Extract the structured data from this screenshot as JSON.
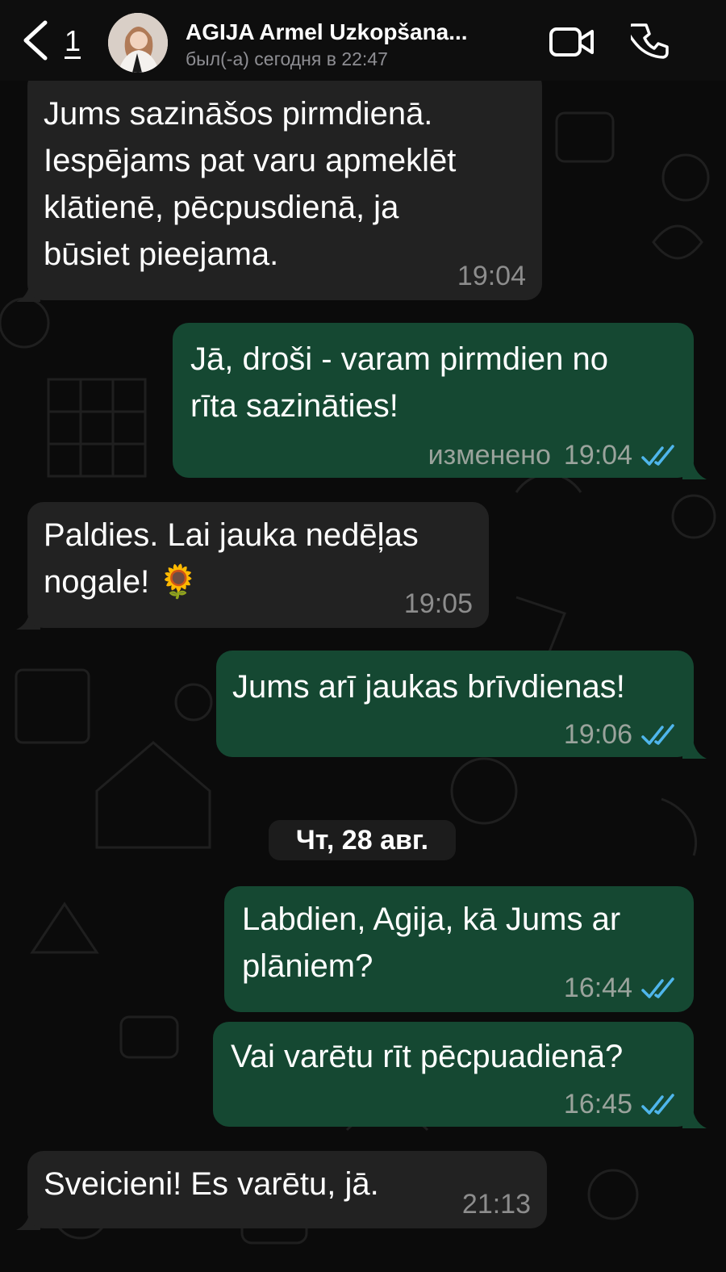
{
  "header": {
    "unread_count": "1",
    "contact_name": "AGIJA Armel Uzkopšana...",
    "status": "был(-а) сегодня в 22:47"
  },
  "colors": {
    "background": "#0b0b0b",
    "incoming_bubble": "#222222",
    "outgoing_bubble": "#154832",
    "read_checks": "#4fb6ec",
    "meta_text": "#9aa39c"
  },
  "icons": [
    "back-chevron-icon",
    "video-camera-icon",
    "phone-icon",
    "double-check-icon",
    "sunflower-emoji"
  ],
  "messages": [
    {
      "direction": "in",
      "lines": [
        "Jums sazināšos pirmdienā.",
        "Iespējams pat varu apmeklēt",
        "klātienē, pēcpusdienā, ja",
        "būsiet pieejama."
      ],
      "time": "19:04"
    },
    {
      "direction": "out",
      "lines": [
        "Jā, droši - varam pirmdien no",
        "rīta sazināties!"
      ],
      "edited": "изменено",
      "time": "19:04",
      "status": "read"
    },
    {
      "direction": "in",
      "lines": [
        "Paldies. Lai jauka nedēļas",
        "nogale! 🌻"
      ],
      "time": "19:05"
    },
    {
      "direction": "out",
      "lines": [
        "Jums arī jaukas brīvdienas!"
      ],
      "time": "19:06",
      "status": "read"
    },
    {
      "direction": "out",
      "lines": [
        "Labdien, Agija, kā Jums ar",
        "plāniem?"
      ],
      "time": "16:44",
      "status": "read"
    },
    {
      "direction": "out",
      "lines": [
        "Vai varētu rīt pēcpuadienā?"
      ],
      "time": "16:45",
      "status": "read"
    },
    {
      "direction": "in",
      "lines": [
        "Sveicieni! Es varētu, jā."
      ],
      "time": "21:13"
    }
  ],
  "date_separator": "Чт, 28 авг."
}
